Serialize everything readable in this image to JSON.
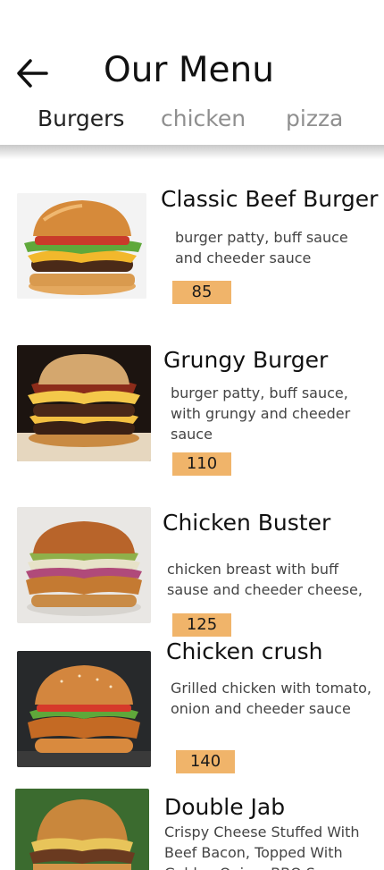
{
  "header": {
    "back_icon": "arrow-left-icon",
    "title": "Our Menu"
  },
  "tabs": [
    {
      "label": "Burgers",
      "active": true
    },
    {
      "label": "chicken",
      "active": false
    },
    {
      "label": "pizza",
      "active": false
    }
  ],
  "items": [
    {
      "name": "Classic Beef Burger",
      "description": "burger patty, buff sauce and cheeder sauce",
      "price": "85"
    },
    {
      "name": "Grungy Burger",
      "description": "burger patty, buff sauce, with grungy and cheeder sauce",
      "price": "110"
    },
    {
      "name": "Chicken Buster",
      "description": "chicken breast with buff sause and cheeder cheese,",
      "price": "125"
    },
    {
      "name": "Chicken crush",
      "description": "Grilled chicken with tomato, onion and cheeder sauce",
      "price": "140"
    },
    {
      "name": "Double Jab",
      "description": "Crispy Cheese Stuffed With Beef Bacon, Topped With Golden Onion, BBQ S...",
      "price": ""
    }
  ],
  "colors": {
    "price_badge": "#f0b46a",
    "active_tab": "#222222",
    "inactive_tab": "#8f8f8f"
  }
}
